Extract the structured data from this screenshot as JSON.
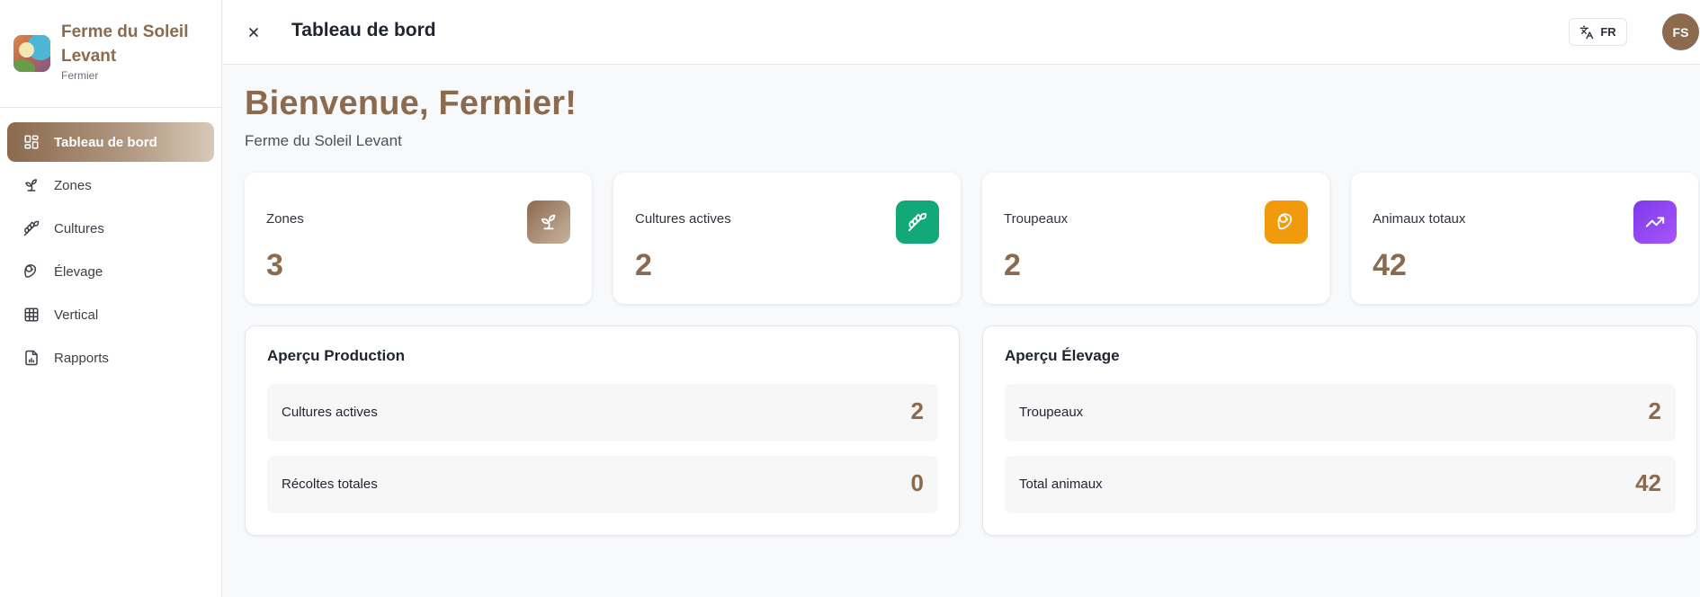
{
  "brand": {
    "name": "Ferme du Soleil Levant",
    "role": "Fermier"
  },
  "sidebar": {
    "items": [
      {
        "label": "Tableau de bord",
        "icon": "dashboard-icon",
        "active": true
      },
      {
        "label": "Zones",
        "icon": "sprout-icon"
      },
      {
        "label": "Cultures",
        "icon": "wheat-icon"
      },
      {
        "label": "Élevage",
        "icon": "meat-icon"
      },
      {
        "label": "Vertical",
        "icon": "grid-icon"
      },
      {
        "label": "Rapports",
        "icon": "report-icon"
      }
    ]
  },
  "header": {
    "title": "Tableau de bord",
    "language": "FR",
    "avatar_initials": "FS"
  },
  "main": {
    "welcome": "Bienvenue, Fermier!",
    "farm_name": "Ferme du Soleil Levant",
    "stats": [
      {
        "label": "Zones",
        "value": "3",
        "icon": "sprout-icon",
        "color": "#8b6a4e"
      },
      {
        "label": "Cultures actives",
        "value": "2",
        "icon": "wheat-icon",
        "color": "#12a878"
      },
      {
        "label": "Troupeaux",
        "value": "2",
        "icon": "meat-icon",
        "color": "#f19a0b"
      },
      {
        "label": "Animaux totaux",
        "value": "42",
        "icon": "trending-up-icon",
        "color": "#7c3aed"
      }
    ],
    "production": {
      "title": "Aperçu Production",
      "rows": [
        {
          "label": "Cultures actives",
          "value": "2"
        },
        {
          "label": "Récoltes totales",
          "value": "0"
        }
      ]
    },
    "livestock": {
      "title": "Aperçu Élevage",
      "rows": [
        {
          "label": "Troupeaux",
          "value": "2"
        },
        {
          "label": "Total animaux",
          "value": "42"
        }
      ]
    }
  },
  "colors": {
    "accent": "#8b6a4e",
    "green": "#12a878",
    "orange": "#f19a0b",
    "purple": "#7c3aed"
  }
}
